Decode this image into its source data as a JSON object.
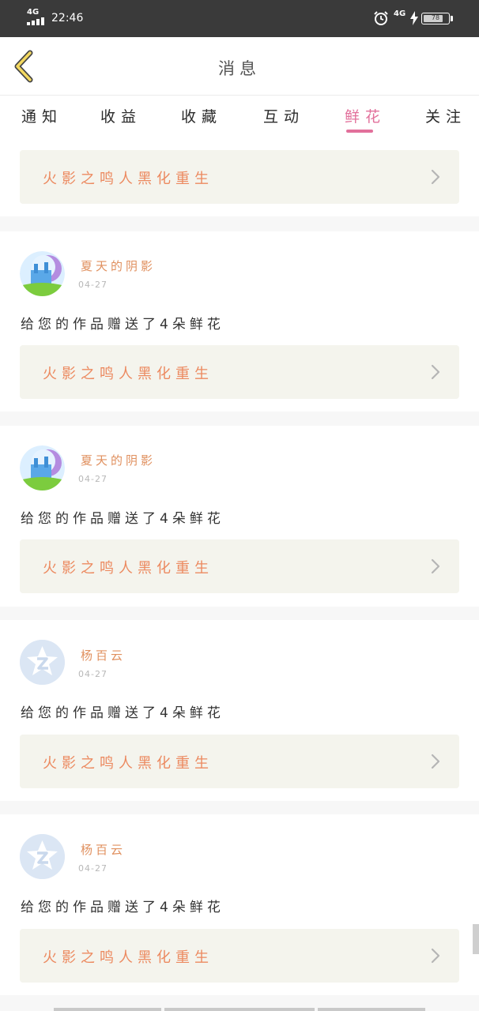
{
  "status_bar": {
    "network": "4G",
    "time": "22:46",
    "network_right": "4G",
    "battery_level": "78"
  },
  "header": {
    "title": "消息"
  },
  "tabs": [
    {
      "label": "通知",
      "active": false
    },
    {
      "label": "收益",
      "active": false
    },
    {
      "label": "收藏",
      "active": false
    },
    {
      "label": "互动",
      "active": false
    },
    {
      "label": "鲜花",
      "active": true
    },
    {
      "label": "关注",
      "active": false
    }
  ],
  "messages": [
    {
      "work_title": "火影之鸣人黑化重生"
    },
    {
      "user": "夏天的阴影",
      "date": "04-27",
      "text": "给您的作品赠送了4朵鲜花",
      "work_title": "火影之鸣人黑化重生",
      "avatar": "castle-avatar"
    },
    {
      "user": "夏天的阴影",
      "date": "04-27",
      "text": "给您的作品赠送了4朵鲜花",
      "work_title": "火影之鸣人黑化重生",
      "avatar": "castle-avatar"
    },
    {
      "user": "杨百云",
      "date": "04-27",
      "text": "给您的作品赠送了4朵鲜花",
      "work_title": "火影之鸣人黑化重生",
      "avatar": "default-qq-avatar"
    },
    {
      "user": "杨百云",
      "date": "04-27",
      "text": "给您的作品赠送了4朵鲜花",
      "work_title": "火影之鸣人黑化重生",
      "avatar": "default-qq-avatar"
    }
  ],
  "colors": {
    "accent": "#e2709b",
    "username": "#e0905f",
    "work_title": "#ec8a60",
    "status_bar": "#3a3a3a"
  }
}
